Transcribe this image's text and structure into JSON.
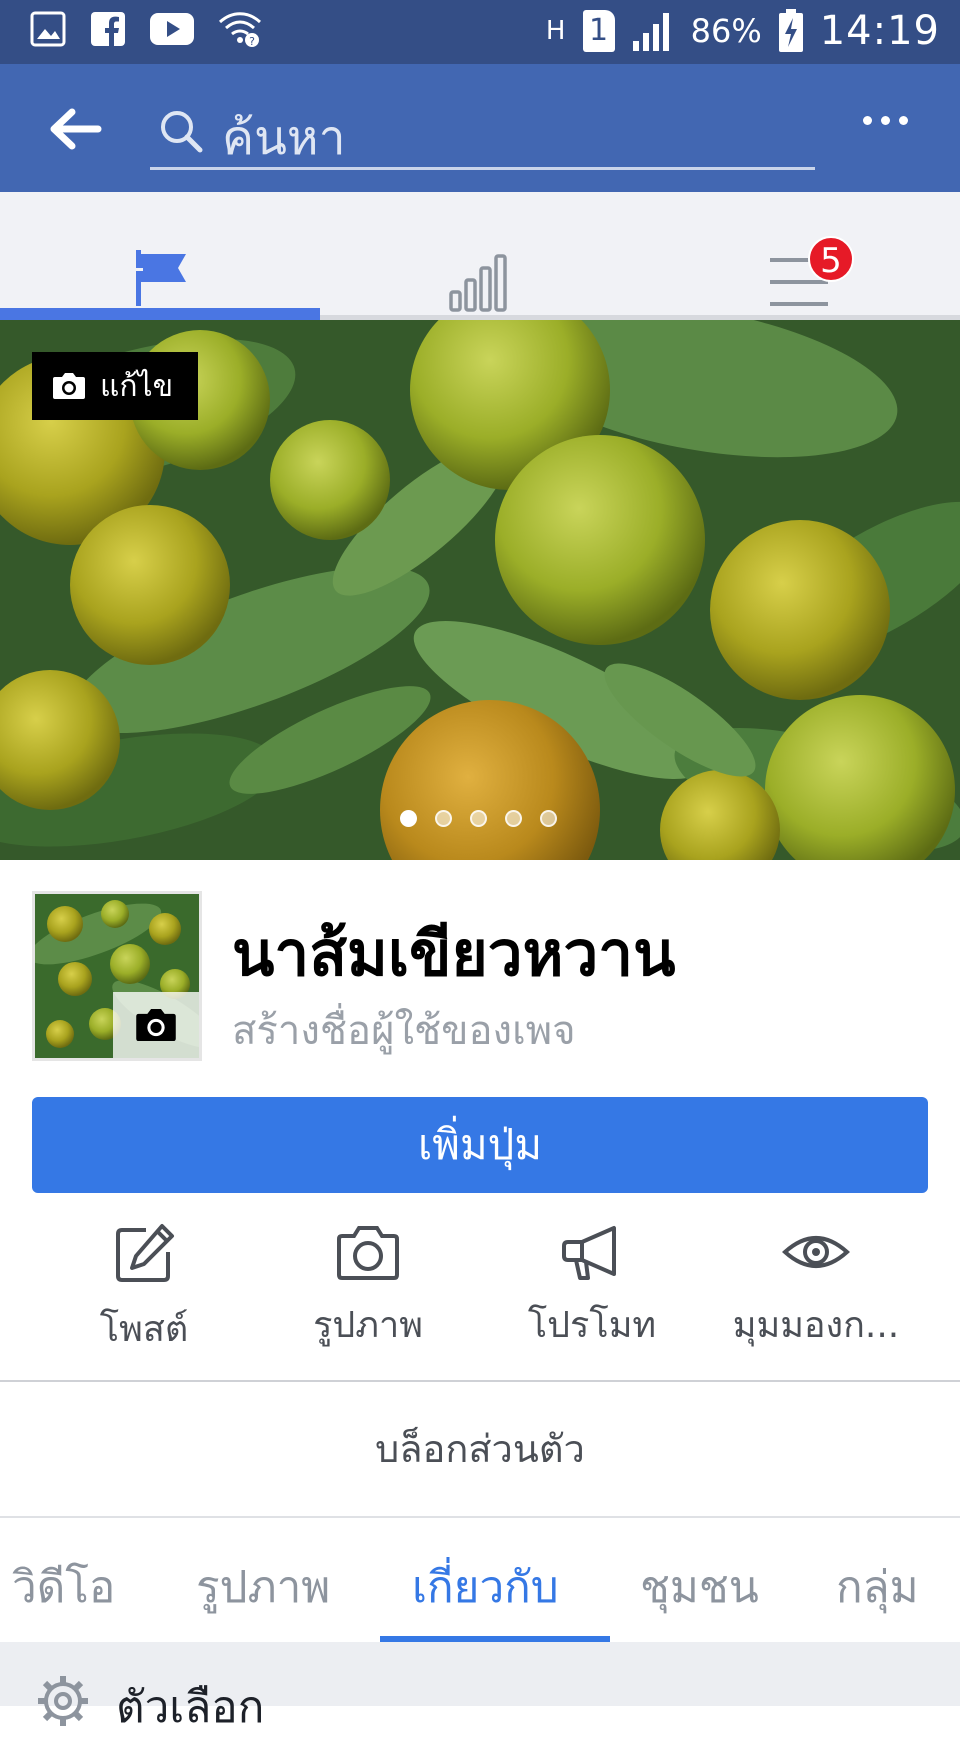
{
  "status_bar": {
    "battery": "86%",
    "time": "14:19",
    "sim": "1",
    "network": "H",
    "icons": [
      "gallery-icon",
      "facebook-icon",
      "youtube-icon",
      "wifi-icon"
    ]
  },
  "header": {
    "search_placeholder": "ค้นหา"
  },
  "nav": {
    "tabs": [
      "flag-icon",
      "chart-icon",
      "menu-icon"
    ],
    "notification_count": "5"
  },
  "cover": {
    "edit_label": "แก้ไข",
    "slides": 5,
    "active_slide": 1
  },
  "page": {
    "name": "นาส้มเขียวหวาน",
    "username_hint": "สร้างชื่อผู้ใช้ของเพจ"
  },
  "add_button": "เพิ่มปุ่ม",
  "actions": [
    {
      "label": "โพสต์",
      "icon": "edit-icon"
    },
    {
      "label": "รูปภาพ",
      "icon": "camera-icon"
    },
    {
      "label": "โปรโมท",
      "icon": "megaphone-icon"
    },
    {
      "label": "มุมมองก...",
      "icon": "eye-icon"
    }
  ],
  "privacy_label": "บล็อกส่วนตัว",
  "page_tabs": [
    {
      "label": "วิดีโอ"
    },
    {
      "label": "รูปภาพ"
    },
    {
      "label": "เกี่ยวกับ",
      "active": true
    },
    {
      "label": "ชุมชน"
    },
    {
      "label": "กลุ่ม"
    }
  ],
  "options_label": "ตัวเลือก",
  "colors": {
    "header": "#4267b2",
    "status_bar": "#344e86",
    "accent": "#3578e5",
    "badge": "#e61a27"
  }
}
